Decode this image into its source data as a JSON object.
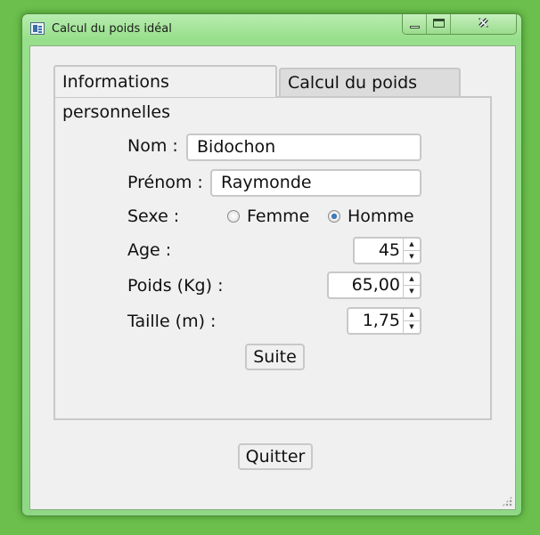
{
  "window": {
    "title": "Calcul du poids idéal",
    "close_symbol": "✕"
  },
  "tabs": [
    {
      "label": "Informations personnelles",
      "active": true
    },
    {
      "label": "Calcul du poids idéal",
      "active": false
    }
  ],
  "form": {
    "nom_label": "Nom  :",
    "nom_value": "Bidochon",
    "prenom_label": "Prénom :",
    "prenom_value": "Raymonde",
    "sexe_label": "Sexe :",
    "sexe_options": [
      {
        "label": "Femme",
        "checked": false
      },
      {
        "label": "Homme",
        "checked": true
      }
    ],
    "age_label": "Age :",
    "age_value": "45",
    "poids_label": "Poids (Kg) :",
    "poids_value": "65,00",
    "taille_label": "Taille (m) :",
    "taille_value": "1,75",
    "suite_label": "Suite"
  },
  "footer": {
    "quit_label": "Quitter"
  },
  "colors": {
    "desktop": "#6cbf4c",
    "titlebar": "#98df8c",
    "client": "#f0f0f0",
    "radio_checked": "#1a4f8a"
  },
  "icons": {
    "app": "app-window-icon",
    "spin_up": "▲",
    "spin_down": "▼"
  }
}
